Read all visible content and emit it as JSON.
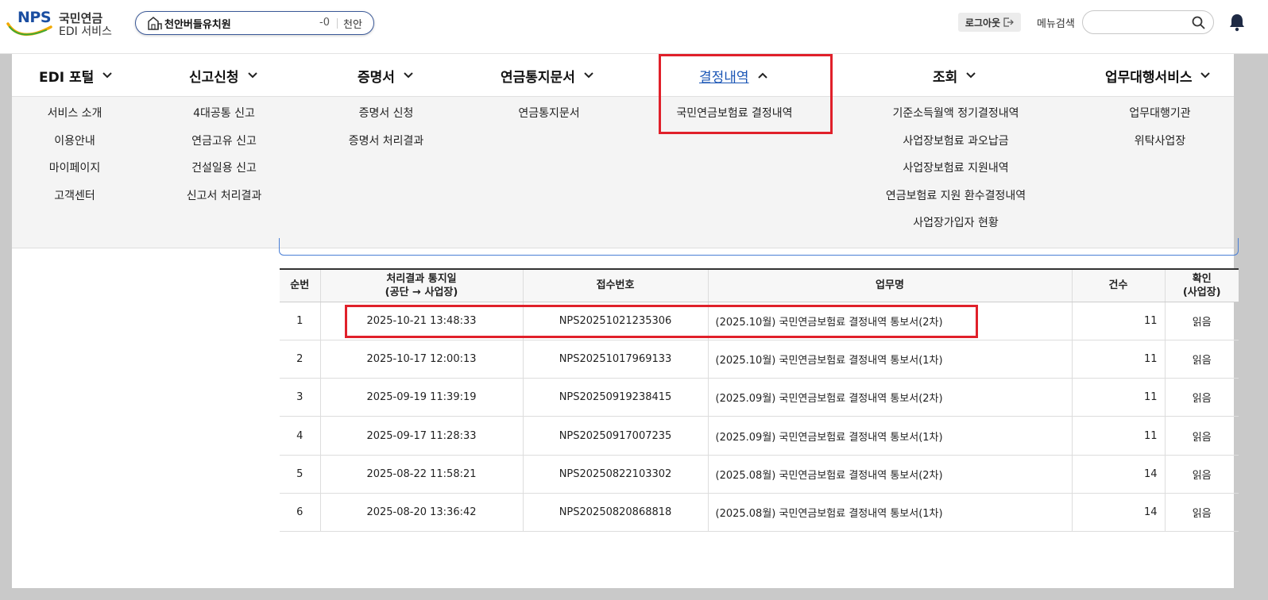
{
  "header": {
    "logo_nps": "NPS",
    "logo_kr": "국민연금",
    "logo_sub": "EDI 서비스",
    "org_name": "천안버들유치원",
    "org_code": "-0",
    "org_region": "천안",
    "logout_label": "로그아웃",
    "menu_search_label": "메뉴검색",
    "menu_search_value": ""
  },
  "nav": [
    {
      "label": "EDI 포털",
      "chevron": "down"
    },
    {
      "label": "신고신청",
      "chevron": "down"
    },
    {
      "label": "증명서",
      "chevron": "down"
    },
    {
      "label": "연금통지문서",
      "chevron": "down"
    },
    {
      "label": "결정내역",
      "chevron": "up"
    },
    {
      "label": "조회",
      "chevron": "down"
    },
    {
      "label": "업무대행서비스",
      "chevron": "down"
    }
  ],
  "submenu": {
    "c0": [
      "서비스 소개",
      "이용안내",
      "마이페이지",
      "고객센터"
    ],
    "c1": [
      "4대공통 신고",
      "연금고유 신고",
      "건설일용 신고",
      "신고서 처리결과"
    ],
    "c2": [
      "증명서 신청",
      "증명서 처리결과"
    ],
    "c3": [
      "연금통지문서"
    ],
    "c4": [
      "국민연금보험료 결정내역"
    ],
    "c5": [
      "기준소득월액 정기결정내역",
      "사업장보험료 과오납금",
      "사업장보험료 지원내역",
      "연금보험료 지원 환수결정내역",
      "사업장가입자 현황"
    ],
    "c6": [
      "업무대행기관",
      "위탁사업장"
    ]
  },
  "table": {
    "headers": {
      "no": "순번",
      "date_l1": "처리결과 통지일",
      "date_l2": "(공단 → 사업장)",
      "receipt": "접수번호",
      "task": "업무명",
      "count": "건수",
      "confirm_l1": "확인",
      "confirm_l2": "(사업장)"
    },
    "rows": [
      {
        "no": "1",
        "date": "2025-10-21 13:48:33",
        "receipt": "NPS20251021235306",
        "task": "(2025.10월) 국민연금보험료 결정내역 통보서(2차)",
        "count": "11",
        "confirm": "읽음"
      },
      {
        "no": "2",
        "date": "2025-10-17 12:00:13",
        "receipt": "NPS20251017969133",
        "task": "(2025.10월) 국민연금보험료 결정내역 통보서(1차)",
        "count": "11",
        "confirm": "읽음"
      },
      {
        "no": "3",
        "date": "2025-09-19 11:39:19",
        "receipt": "NPS20250919238415",
        "task": "(2025.09월) 국민연금보험료 결정내역 통보서(2차)",
        "count": "11",
        "confirm": "읽음"
      },
      {
        "no": "4",
        "date": "2025-09-17 11:28:33",
        "receipt": "NPS20250917007235",
        "task": "(2025.09월) 국민연금보험료 결정내역 통보서(1차)",
        "count": "11",
        "confirm": "읽음"
      },
      {
        "no": "5",
        "date": "2025-08-22 11:58:21",
        "receipt": "NPS20250822103302",
        "task": "(2025.08월) 국민연금보험료 결정내역 통보서(2차)",
        "count": "14",
        "confirm": "읽음"
      },
      {
        "no": "6",
        "date": "2025-08-20 13:36:42",
        "receipt": "NPS20250820868818",
        "task": "(2025.08월) 국민연금보험료 결정내역 통보서(1차)",
        "count": "14",
        "confirm": "읽음"
      }
    ]
  },
  "colors": {
    "accent": "#1a55b5",
    "highlight": "#e0202a",
    "org_border": "#3b5998"
  }
}
